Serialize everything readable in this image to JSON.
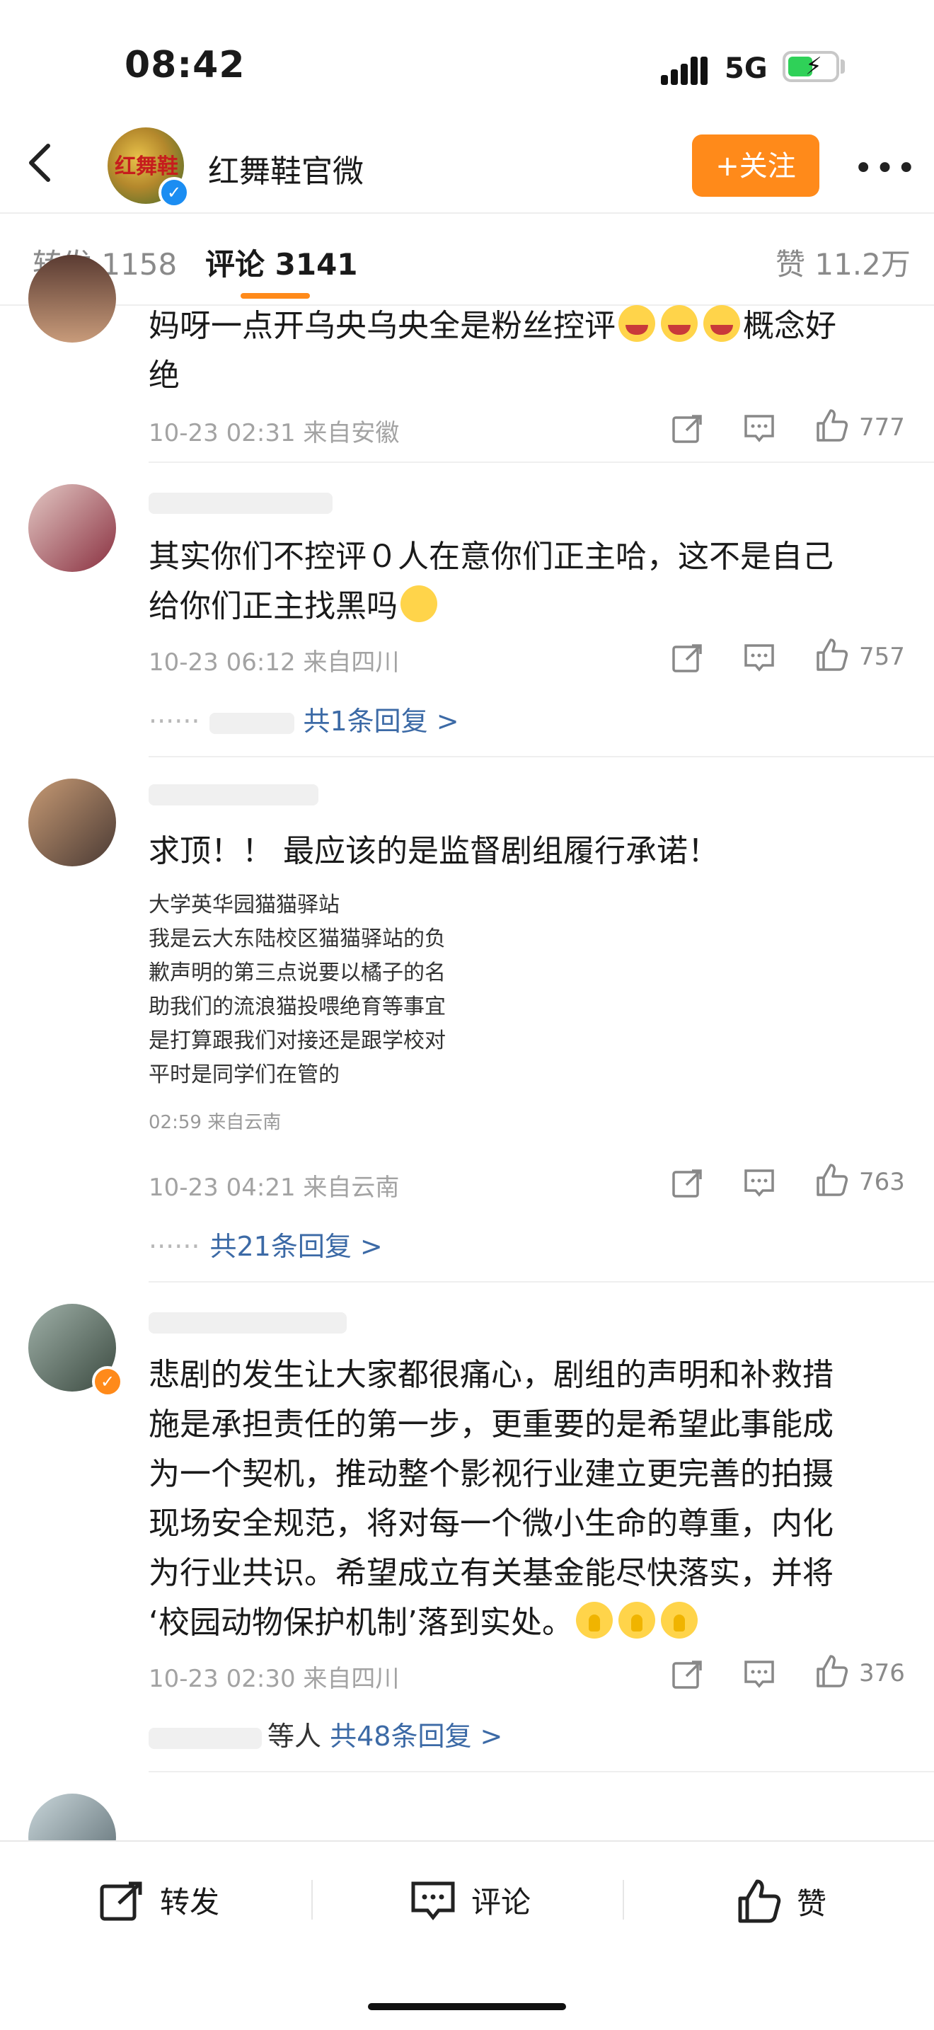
{
  "status_bar": {
    "time": "08:42",
    "network": "5G"
  },
  "header": {
    "account_name": "红舞鞋官微",
    "follow_label": "+关注",
    "avatar_text": "红舞鞋"
  },
  "tabs": {
    "repost": "转发 1158",
    "comment": "评论 3141",
    "like": "赞 11.2万"
  },
  "comments": [
    {
      "text_line1": "妈呀一点开乌央乌央全是粉丝控评",
      "text_line1_tail": "概念好",
      "text_line2": "绝",
      "meta": "10-23 02:31 来自安徽",
      "likes": "777"
    },
    {
      "text_line1": "其实你们不控评０人在意你们正主哈，这不是自己",
      "text_line2": "给你们正主找黑吗",
      "meta": "10-23 06:12 来自四川",
      "likes": "757",
      "reply_link": "共1条回复 >"
    },
    {
      "text": "求顶！！ 最应该的是监督剧组履行承诺！",
      "quote_lines": [
        "大学英华园猫猫驿站",
        "我是云大东陆校区猫猫驿站的负",
        "歉声明的第三点说要以橘子的名",
        "助我们的流浪猫投喂绝育等事宜",
        "是打算跟我们对接还是跟学校对",
        "平时是同学们在管的"
      ],
      "quote_meta": "02:59 来自云南",
      "meta": "10-23 04:21 来自云南",
      "likes": "763",
      "reply_link": "共21条回复 >"
    },
    {
      "lines": [
        "悲剧的发生让大家都很痛心，剧组的声明和补救措",
        "施是承担责任的第一步，更重要的是希望此事能成",
        "为一个契机，推动整个影视行业建立更完善的拍摄",
        "现场安全规范，将对每一个微小生命的尊重，内化",
        "为行业共识。希望成立有关基金能尽快落实，并将",
        "‘校园动物保护机制’落到实处。"
      ],
      "meta": "10-23 02:30 来自四川",
      "likes": "376",
      "reply_link": "共48条回复 >",
      "reply_prefix": "等人"
    }
  ],
  "bottom_bar": {
    "repost": "转发",
    "comment": "评论",
    "like": "赞"
  },
  "colors": {
    "accent": "#ff8a1a",
    "link": "#3c6aa6",
    "meta": "#a3a3a3"
  }
}
